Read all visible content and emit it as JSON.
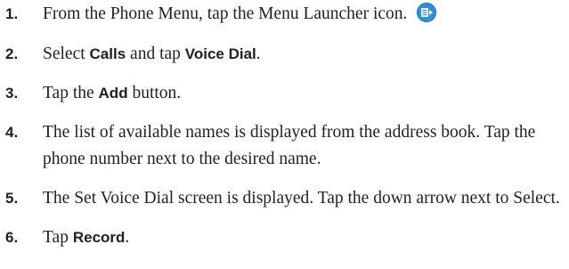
{
  "steps": [
    {
      "num": "1.",
      "text_before": "From the Phone Menu, tap the Menu Launcher icon.",
      "icon": "menu-launcher-icon"
    },
    {
      "num": "2.",
      "select": "Select ",
      "calls": "Calls",
      "and_tap": " and tap ",
      "voice_dial": "Voice Dial",
      "period": "."
    },
    {
      "num": "3.",
      "tap_the": "Tap the ",
      "add": "Add",
      "button_text": " button."
    },
    {
      "num": "4.",
      "text": "The list of available names is displayed from the address book. Tap the phone number next to the desired name."
    },
    {
      "num": "5.",
      "text": "The Set Voice Dial screen is displayed. Tap the down arrow next to Select."
    },
    {
      "num": "6.",
      "tap": "Tap ",
      "record": "Record",
      "period": "."
    }
  ],
  "colors": {
    "text": "#231f20",
    "icon_blue": "#2f8fd8"
  }
}
